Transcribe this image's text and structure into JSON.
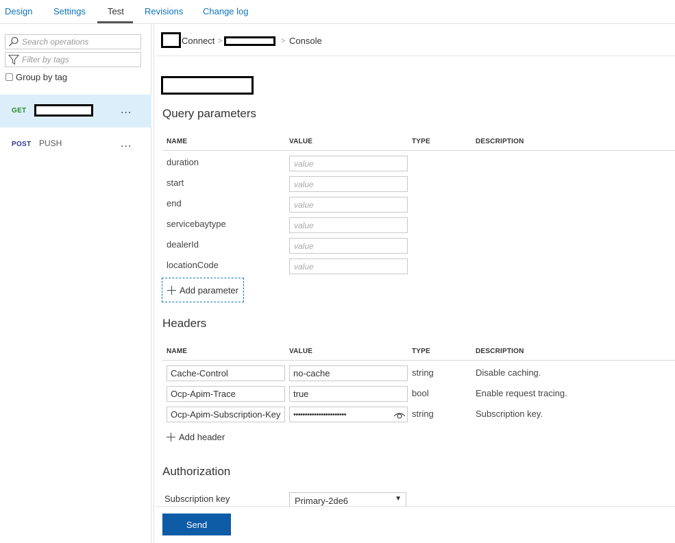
{
  "tabs": {
    "design": "Design",
    "settings": "Settings",
    "test": "Test",
    "revisions": "Revisions",
    "changelog": "Change log",
    "active": "Test"
  },
  "sidebar": {
    "search_placeholder": "Search operations",
    "filter_placeholder": "Filter by tags",
    "group_by_tag": "Group by tag",
    "operations": [
      {
        "method": "GET",
        "name": "",
        "more": "..."
      },
      {
        "method": "POST",
        "name": "PUSH",
        "more": "..."
      }
    ]
  },
  "breadcrumb": {
    "connect": "Connect",
    "sep": ">",
    "console": "Console"
  },
  "query": {
    "title": "Query parameters",
    "columns": {
      "name": "NAME",
      "value": "VALUE",
      "type": "TYPE",
      "description": "DESCRIPTION"
    },
    "params": [
      {
        "name": "duration",
        "placeholder": "value"
      },
      {
        "name": "start",
        "placeholder": "value"
      },
      {
        "name": "end",
        "placeholder": "value"
      },
      {
        "name": "servicebaytype",
        "placeholder": "value"
      },
      {
        "name": "dealerId",
        "placeholder": "value"
      },
      {
        "name": "locationCode",
        "placeholder": "value"
      }
    ],
    "add_label": "Add parameter"
  },
  "headers": {
    "title": "Headers",
    "columns": {
      "name": "NAME",
      "value": "VALUE",
      "type": "TYPE",
      "description": "DESCRIPTION"
    },
    "rows": [
      {
        "name": "Cache-Control",
        "value": "no-cache",
        "type": "string",
        "description": "Disable caching."
      },
      {
        "name": "Ocp-Apim-Trace",
        "value": "true",
        "type": "bool",
        "description": "Enable request tracing."
      },
      {
        "name": "Ocp-Apim-Subscription-Key",
        "value": "•••••••••••••••••••••••",
        "type": "string",
        "description": "Subscription key."
      }
    ],
    "add_label": "Add header"
  },
  "authorization": {
    "title": "Authorization",
    "subscription_label": "Subscription key",
    "selected": "Primary-2de6"
  },
  "send_label": "Send",
  "colors": {
    "accent": "#0e74bb",
    "send_bg": "#0e5ba6",
    "selected_row": "#ddeefb",
    "get": "#2b8a2b",
    "post": "#2d3a8c"
  }
}
